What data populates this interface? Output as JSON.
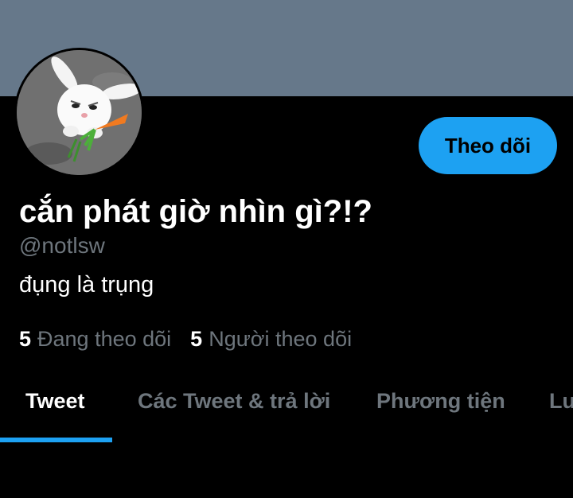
{
  "profile": {
    "display_name": "cắn phát giờ nhìn gì?!?",
    "handle": "@notlsw",
    "bio": "đụng là trụng",
    "follow_label": "Theo dõi",
    "avatar_icon": "white-rabbit-with-carrot-avatar"
  },
  "stats": [
    {
      "count": "5",
      "label": "Đang theo dõi"
    },
    {
      "count": "5",
      "label": "Người theo dõi"
    }
  ],
  "tabs": [
    {
      "label": "Tweet",
      "active": true
    },
    {
      "label": "Các Tweet & trả lời",
      "active": false
    },
    {
      "label": "Phương tiện",
      "active": false
    },
    {
      "label": "Lượt thích",
      "active": false
    }
  ],
  "colors": {
    "accent": "#1da1f2",
    "banner": "#66788a",
    "muted_text": "#6e767d",
    "background": "#000000"
  }
}
